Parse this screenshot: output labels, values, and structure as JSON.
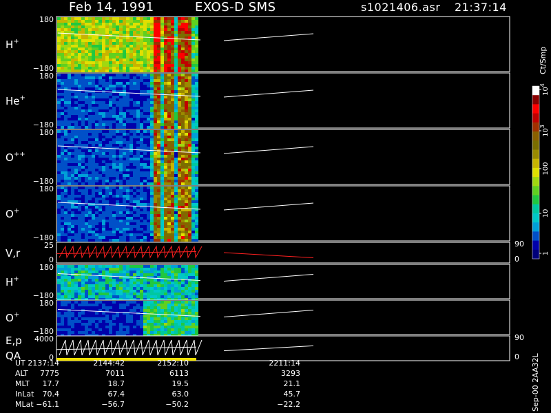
{
  "header": {
    "date": "Feb 14, 1991",
    "instrument": "EXOS-D SMS",
    "file": "s1021406.asr",
    "time": "21:37:14"
  },
  "colorbar": {
    "unit_label": "Ct/Smp",
    "ticks": [
      "1",
      "10",
      "100",
      "10",
      "10"
    ],
    "exponents": [
      "",
      "",
      "",
      "3",
      "4"
    ],
    "colors": [
      "#00007a",
      "#0000aa",
      "#0050c8",
      "#00a0d8",
      "#00c8c8",
      "#00c8a0",
      "#20c840",
      "#60d020",
      "#a0d810",
      "#e0e000",
      "#c8b400",
      "#9a8a00",
      "#7a6e00",
      "#8a6000",
      "#a03000",
      "#c00000",
      "#ff0000",
      "#8a0000",
      "#ffffff"
    ]
  },
  "side_label": "Sep-00 2AA32L",
  "chart_data": [
    {
      "type": "heatmap",
      "panel": "H+",
      "label_base": "H",
      "label_sup": "+",
      "y_ticks": [
        "180",
        "−180"
      ],
      "ylim": [
        -180,
        180
      ]
    },
    {
      "type": "heatmap",
      "panel": "He+",
      "label_base": "He",
      "label_sup": "+",
      "y_ticks": [
        "180",
        "−180"
      ],
      "ylim": [
        -180,
        180
      ]
    },
    {
      "type": "heatmap",
      "panel": "O++",
      "label_base": "O",
      "label_sup": "++",
      "y_ticks": [
        "180",
        "−180"
      ],
      "ylim": [
        -180,
        180
      ]
    },
    {
      "type": "heatmap",
      "panel": "O+",
      "label_base": "O",
      "label_sup": "+",
      "y_ticks": [
        "180",
        "−180"
      ],
      "ylim": [
        -180,
        180
      ]
    },
    {
      "type": "line",
      "panel": "V,r",
      "label_base": "V,r",
      "label_sup": "",
      "y_ticks": [
        "25",
        "0"
      ],
      "right_ticks": [
        "90",
        "0"
      ],
      "ylim": [
        0,
        25
      ]
    },
    {
      "type": "heatmap",
      "panel": "H+ (2)",
      "label_base": "H",
      "label_sup": "+",
      "y_ticks": [
        "180",
        "−180"
      ],
      "ylim": [
        -180,
        180
      ]
    },
    {
      "type": "heatmap",
      "panel": "O+ (2)",
      "label_base": "O",
      "label_sup": "+",
      "y_ticks": [
        "180",
        "−180"
      ],
      "ylim": [
        -180,
        180
      ]
    },
    {
      "type": "line",
      "panel": "E,p QA",
      "label_base": "E,p",
      "label_line2": "QA",
      "label_sup": "",
      "y_ticks": [
        "4000",
        "0"
      ],
      "right_ticks": [
        "90",
        "0"
      ],
      "ylim": [
        0,
        4000
      ]
    }
  ],
  "ephemeris": {
    "row_labels": [
      "UT",
      "ALT",
      "MLT",
      "InLat",
      "MLat"
    ],
    "columns": [
      {
        "UT": "2137:14",
        "ALT": "7775",
        "MLT": "17.7",
        "InLat": "70.4",
        "MLat": "−61.1"
      },
      {
        "UT": "2144:42",
        "ALT": "7011",
        "MLT": "18.7",
        "InLat": "67.4",
        "MLat": "−56.7"
      },
      {
        "UT": "2152:10",
        "ALT": "6113",
        "MLT": "19.5",
        "InLat": "63.0",
        "MLat": "−50.2"
      },
      {
        "UT": "2211:14",
        "ALT": "3293",
        "MLT": "21.1",
        "InLat": "45.7",
        "MLat": "−22.2"
      }
    ]
  }
}
